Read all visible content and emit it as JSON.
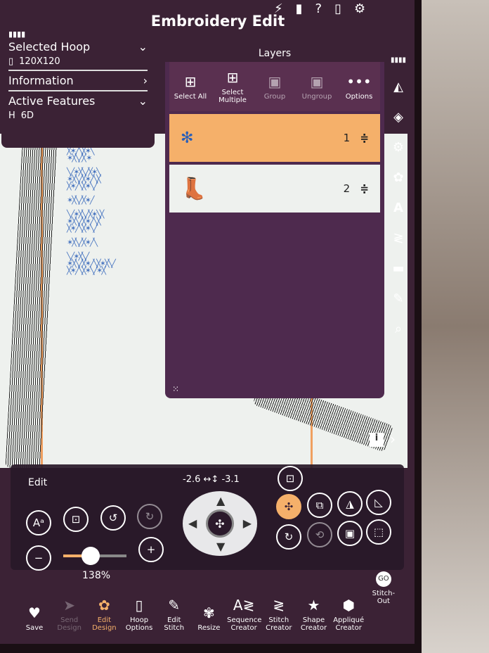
{
  "title": "Embroidery Edit",
  "top_icons": [
    "menu-icon",
    "stitch-icon",
    "book-icon",
    "help-icon",
    "manual-icon",
    "settings-icon"
  ],
  "left_panel": {
    "selected_hoop_label": "Selected Hoop",
    "hoop_value": "120X120",
    "information_label": "Information",
    "active_features_label": "Active Features",
    "feature_value": "6D"
  },
  "layers": {
    "title": "Layers",
    "tools": [
      {
        "label": "Select All",
        "icon": "select-all-icon",
        "enabled": true
      },
      {
        "label": "Select Multiple",
        "icon": "select-multiple-icon",
        "enabled": true
      },
      {
        "label": "Group",
        "icon": "group-icon",
        "enabled": false
      },
      {
        "label": "Ungroup",
        "icon": "ungroup-icon",
        "enabled": false
      },
      {
        "label": "Options",
        "icon": "more-icon",
        "enabled": true
      }
    ],
    "items": [
      {
        "number": "1",
        "thumb": "floral-pattern",
        "selected": true
      },
      {
        "number": "2",
        "thumb": "boot",
        "selected": false
      }
    ]
  },
  "edit": {
    "title": "Edit",
    "x_offset": "-2.6",
    "y_offset": "-3.1",
    "zoom": "138%",
    "zoom_level": 0.38
  },
  "bottom": [
    {
      "label": "Save",
      "icon": "heart-icon"
    },
    {
      "label": "Send Design",
      "icon": "send-icon",
      "enabled": false
    },
    {
      "label": "Edit Design",
      "icon": "edit-design-icon",
      "active": true
    },
    {
      "label": "Hoop Options",
      "icon": "hoop-icon"
    },
    {
      "label": "Edit Stitch",
      "icon": "edit-stitch-icon"
    },
    {
      "label": "Resize",
      "icon": "resize-icon"
    },
    {
      "label": "Sequence Creator",
      "icon": "sequence-icon"
    },
    {
      "label": "Stitch Creator",
      "icon": "stitch-creator-icon"
    },
    {
      "label": "Shape Creator",
      "icon": "shape-icon"
    },
    {
      "label": "Appliqué Creator",
      "icon": "applique-icon"
    },
    {
      "label": "Stitch-Out",
      "icon": "go-icon"
    }
  ],
  "colors": {
    "accent": "#f5b06a",
    "panel": "#3b2235",
    "layers_bg": "#4e2a4e"
  }
}
